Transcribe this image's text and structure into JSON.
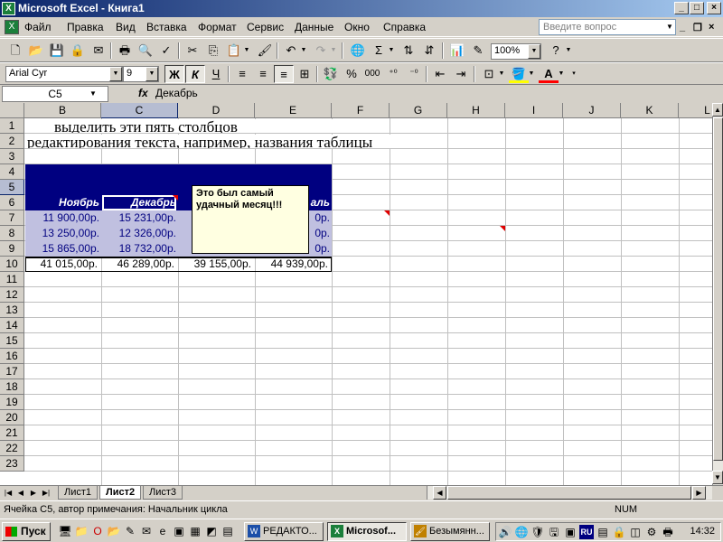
{
  "window": {
    "title": "Microsoft Excel - Книга1",
    "app_icon": "X"
  },
  "menu": {
    "items": [
      "Файл",
      "Правка",
      "Вид",
      "Вставка",
      "Формат",
      "Сервис",
      "Данные",
      "Окно",
      "Справка"
    ],
    "ask_placeholder": "Введите вопрос"
  },
  "toolbar": {
    "zoom": "100%",
    "font_name": "Arial Cyr",
    "font_size": "9",
    "bold_label": "Ж",
    "italic_label": "К",
    "underline_label": "Ч",
    "percent_label": "%",
    "thousands_label": "000"
  },
  "formula_bar": {
    "name_box": "C5",
    "fx": "fx",
    "content": "Декабрь"
  },
  "columns": [
    "B",
    "C",
    "D",
    "E",
    "F",
    "G",
    "H",
    "I",
    "J",
    "K",
    "L"
  ],
  "rows": [
    "1",
    "2",
    "3",
    "4",
    "5",
    "6",
    "7",
    "8",
    "9",
    "10",
    "11",
    "12",
    "13",
    "14",
    "15",
    "16",
    "17",
    "18",
    "19",
    "20",
    "21",
    "22",
    "23"
  ],
  "sheet": {
    "row1_text": "выделить эти пять столбцов",
    "row2_text": "редактирования текста, например, названия таблицы",
    "months": [
      "Ноябрь",
      "Декабрь",
      "",
      "аль"
    ],
    "row6": [
      "11 900,00р.",
      "15 231,00р.",
      "",
      "0р."
    ],
    "row7": [
      "13 250,00р.",
      "12 326,00р.",
      "",
      "0р."
    ],
    "row8": [
      "15 865,00р.",
      "18 732,00р.",
      "",
      "0р."
    ],
    "totals": [
      "41 015,00р.",
      "46 289,00р.",
      "39 155,00р.",
      "44 939,00р."
    ]
  },
  "comment": {
    "text": "Это был самый удачный месяц!!!"
  },
  "sheet_tabs": [
    "Лист1",
    "Лист2",
    "Лист3"
  ],
  "active_tab_index": 1,
  "status": {
    "message": "Ячейка C5, автор примечания: Начальник цикла",
    "num": "NUM"
  },
  "taskbar": {
    "start": "Пуск",
    "buttons": [
      "РЕДАКТО...",
      "Microsof...",
      "Безымянн..."
    ],
    "clock": "14:32",
    "lang": "RU"
  },
  "colors": {
    "title_start": "#0a246a",
    "table_header": "#000080",
    "comment_bg": "#ffffe1"
  }
}
